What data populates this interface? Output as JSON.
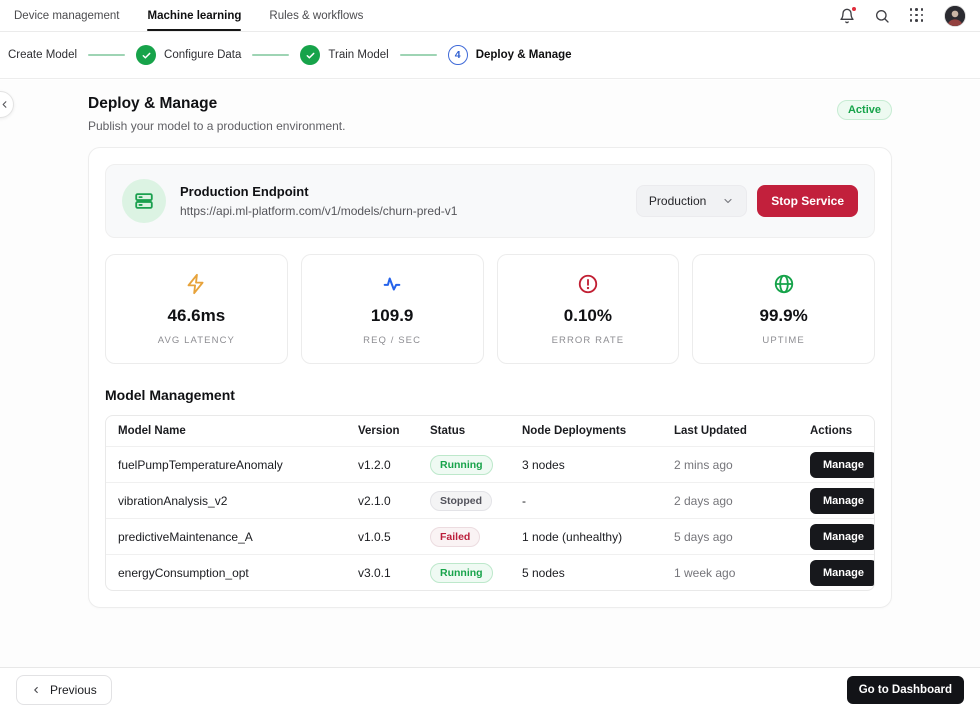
{
  "nav": {
    "tabs": [
      {
        "label": "Device management"
      },
      {
        "label": "Machine learning"
      },
      {
        "label": "Rules & workflows"
      }
    ]
  },
  "stepper": {
    "steps": [
      {
        "label": "Create Model"
      },
      {
        "label": "Configure Data"
      },
      {
        "label": "Train Model"
      },
      {
        "label": "Deploy & Manage",
        "number": "4"
      }
    ]
  },
  "page": {
    "title": "Deploy & Manage",
    "subtitle": "Publish your model to a production environment.",
    "status_badge": "Active"
  },
  "endpoint": {
    "title": "Production Endpoint",
    "url": "https://api.ml-platform.com/v1/models/churn-pred-v1",
    "environment": "Production",
    "stop_label": "Stop Service"
  },
  "metrics": [
    {
      "icon": "lightning-icon",
      "value": "46.6ms",
      "label": "AVG LATENCY",
      "color": "#e7a33b"
    },
    {
      "icon": "activity-icon",
      "value": "109.9",
      "label": "REQ / SEC",
      "color": "#2563eb"
    },
    {
      "icon": "alert-circle-icon",
      "value": "0.10%",
      "label": "ERROR RATE",
      "color": "#c11f33"
    },
    {
      "icon": "globe-icon",
      "value": "99.9%",
      "label": "UPTIME",
      "color": "#16a34a"
    }
  ],
  "table": {
    "title": "Model Management",
    "headers": [
      "Model Name",
      "Version",
      "Status",
      "Node Deployments",
      "Last Updated",
      "Actions"
    ],
    "manage_label": "Manage",
    "rows": [
      {
        "model": "fuelPumpTemperatureAnomaly",
        "version": "v1.2.0",
        "status": "Running",
        "status_variant": "running",
        "nodes": "3 nodes",
        "updated": "2 mins ago"
      },
      {
        "model": "vibrationAnalysis_v2",
        "version": "v2.1.0",
        "status": "Stopped",
        "status_variant": "stopped",
        "nodes": "-",
        "updated": "2 days ago"
      },
      {
        "model": "predictiveMaintenance_A",
        "version": "v1.0.5",
        "status": "Failed",
        "status_variant": "failed",
        "nodes": "1 node (unhealthy)",
        "updated": "5 days ago"
      },
      {
        "model": "energyConsumption_opt",
        "version": "v3.0.1",
        "status": "Running",
        "status_variant": "running",
        "nodes": "5 nodes",
        "updated": "1 week ago"
      }
    ]
  },
  "footer": {
    "previous_label": "Previous",
    "dashboard_label": "Go to Dashboard"
  }
}
